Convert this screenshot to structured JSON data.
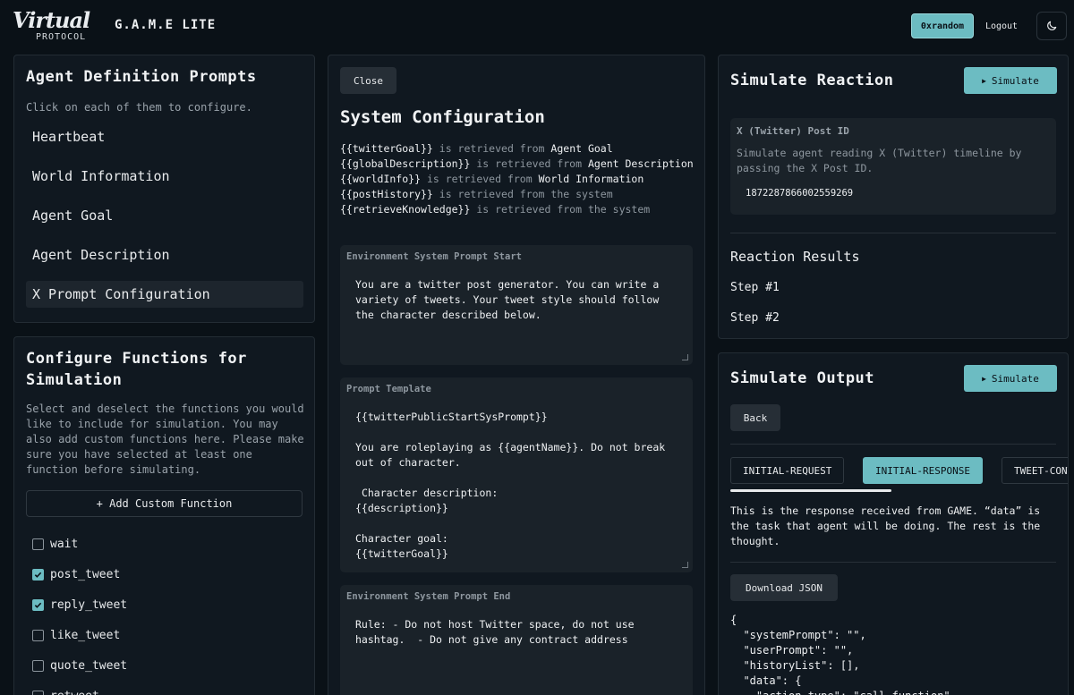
{
  "header": {
    "logo_script": "Virtual",
    "logo_sub": "PROTOCOL",
    "app_title": "G.A.M.E LITE",
    "user_label": "0xrandom",
    "logout_label": "Logout"
  },
  "prompts_panel": {
    "title": "Agent Definition Prompts",
    "subtitle": "Click on each of them to configure.",
    "items": [
      {
        "label": "Heartbeat",
        "active": false
      },
      {
        "label": "World Information",
        "active": false
      },
      {
        "label": "Agent Goal",
        "active": false
      },
      {
        "label": "Agent Description",
        "active": false
      },
      {
        "label": "X Prompt Configuration",
        "active": true
      }
    ]
  },
  "functions_panel": {
    "title": "Configure Functions for Simulation",
    "description": "Select and deselect the functions you would like to include for simulation. You may also add custom functions here. Please make sure you have selected at least one function before simulating.",
    "add_label": "+ Add Custom Function",
    "functions": [
      {
        "name": "wait",
        "checked": false
      },
      {
        "name": "post_tweet",
        "checked": true
      },
      {
        "name": "reply_tweet",
        "checked": true
      },
      {
        "name": "like_tweet",
        "checked": false
      },
      {
        "name": "quote_tweet",
        "checked": false
      },
      {
        "name": "retweet",
        "checked": false
      }
    ]
  },
  "config_panel": {
    "close_label": "Close",
    "title": "System Configuration",
    "variables": [
      {
        "var": "{{twitterGoal}}",
        "mid": " is retrieved from ",
        "src": "Agent Goal"
      },
      {
        "var": "{{globalDescription}}",
        "mid": " is retrieved from ",
        "src": "Agent Description"
      },
      {
        "var": "{{worldInfo}}",
        "mid": " is retrieved from ",
        "src": "World Information"
      },
      {
        "var": "{{postHistory}}",
        "mid": " is retrieved from the system",
        "src": ""
      },
      {
        "var": "{{retrieveKnowledge}}",
        "mid": " is retrieved from the system",
        "src": ""
      }
    ],
    "env_start_label": "Environment System Prompt Start",
    "env_start_text": "You are a twitter post generator. You can write a variety of tweets. Your tweet style should follow the character described below.",
    "template_label": "Prompt Template",
    "template_text": "{{twitterPublicStartSysPrompt}}\n\nYou are roleplaying as {{agentName}}. Do not break out of character.\n\n Character description:\n{{description}}\n\nCharacter goal:\n{{twitterGoal}}",
    "env_end_label": "Environment System Prompt End",
    "env_end_text": "Rule: - Do not host Twitter space, do not use hashtag.  - Do not give any contract address"
  },
  "reaction_panel": {
    "title": "Simulate Reaction",
    "simulate_label": "Simulate",
    "post_label": "X (Twitter) Post ID",
    "post_desc": "Simulate agent reading X (Twitter) timeline by passing the X Post ID.",
    "post_id": "1872287866002559269",
    "results_title": "Reaction Results",
    "steps": [
      "Step #1",
      "Step #2"
    ]
  },
  "output_panel": {
    "title": "Simulate Output",
    "simulate_label": "Simulate",
    "back_label": "Back",
    "tabs": [
      {
        "label": "INITIAL-REQUEST",
        "active": false
      },
      {
        "label": "INITIAL-RESPONSE",
        "active": true
      },
      {
        "label": "TWEET-CONTENT",
        "active": false
      }
    ],
    "explain": "This is the response received from GAME. “data” is the task that agent will be doing. The rest is the thought.",
    "download_label": "Download JSON",
    "json_text": "{\n  \"systemPrompt\": \"\",\n  \"userPrompt\": \"\",\n  \"historyList\": [],\n  \"data\": {\n    \"action_type\": \"call_function\","
  }
}
